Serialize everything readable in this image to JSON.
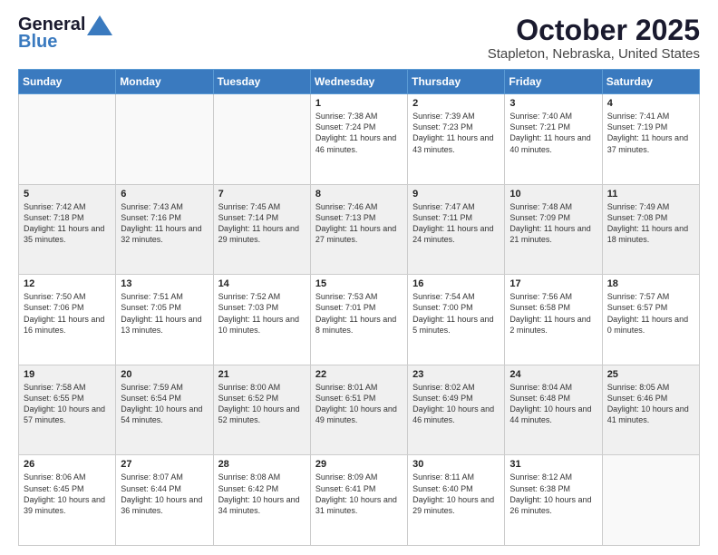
{
  "header": {
    "logo_line1": "General",
    "logo_line2": "Blue",
    "title": "October 2025",
    "subtitle": "Stapleton, Nebraska, United States"
  },
  "weekdays": [
    "Sunday",
    "Monday",
    "Tuesday",
    "Wednesday",
    "Thursday",
    "Friday",
    "Saturday"
  ],
  "weeks": [
    [
      {
        "day": "",
        "info": ""
      },
      {
        "day": "",
        "info": ""
      },
      {
        "day": "",
        "info": ""
      },
      {
        "day": "1",
        "info": "Sunrise: 7:38 AM\nSunset: 7:24 PM\nDaylight: 11 hours and 46 minutes."
      },
      {
        "day": "2",
        "info": "Sunrise: 7:39 AM\nSunset: 7:23 PM\nDaylight: 11 hours and 43 minutes."
      },
      {
        "day": "3",
        "info": "Sunrise: 7:40 AM\nSunset: 7:21 PM\nDaylight: 11 hours and 40 minutes."
      },
      {
        "day": "4",
        "info": "Sunrise: 7:41 AM\nSunset: 7:19 PM\nDaylight: 11 hours and 37 minutes."
      }
    ],
    [
      {
        "day": "5",
        "info": "Sunrise: 7:42 AM\nSunset: 7:18 PM\nDaylight: 11 hours and 35 minutes."
      },
      {
        "day": "6",
        "info": "Sunrise: 7:43 AM\nSunset: 7:16 PM\nDaylight: 11 hours and 32 minutes."
      },
      {
        "day": "7",
        "info": "Sunrise: 7:45 AM\nSunset: 7:14 PM\nDaylight: 11 hours and 29 minutes."
      },
      {
        "day": "8",
        "info": "Sunrise: 7:46 AM\nSunset: 7:13 PM\nDaylight: 11 hours and 27 minutes."
      },
      {
        "day": "9",
        "info": "Sunrise: 7:47 AM\nSunset: 7:11 PM\nDaylight: 11 hours and 24 minutes."
      },
      {
        "day": "10",
        "info": "Sunrise: 7:48 AM\nSunset: 7:09 PM\nDaylight: 11 hours and 21 minutes."
      },
      {
        "day": "11",
        "info": "Sunrise: 7:49 AM\nSunset: 7:08 PM\nDaylight: 11 hours and 18 minutes."
      }
    ],
    [
      {
        "day": "12",
        "info": "Sunrise: 7:50 AM\nSunset: 7:06 PM\nDaylight: 11 hours and 16 minutes."
      },
      {
        "day": "13",
        "info": "Sunrise: 7:51 AM\nSunset: 7:05 PM\nDaylight: 11 hours and 13 minutes."
      },
      {
        "day": "14",
        "info": "Sunrise: 7:52 AM\nSunset: 7:03 PM\nDaylight: 11 hours and 10 minutes."
      },
      {
        "day": "15",
        "info": "Sunrise: 7:53 AM\nSunset: 7:01 PM\nDaylight: 11 hours and 8 minutes."
      },
      {
        "day": "16",
        "info": "Sunrise: 7:54 AM\nSunset: 7:00 PM\nDaylight: 11 hours and 5 minutes."
      },
      {
        "day": "17",
        "info": "Sunrise: 7:56 AM\nSunset: 6:58 PM\nDaylight: 11 hours and 2 minutes."
      },
      {
        "day": "18",
        "info": "Sunrise: 7:57 AM\nSunset: 6:57 PM\nDaylight: 11 hours and 0 minutes."
      }
    ],
    [
      {
        "day": "19",
        "info": "Sunrise: 7:58 AM\nSunset: 6:55 PM\nDaylight: 10 hours and 57 minutes."
      },
      {
        "day": "20",
        "info": "Sunrise: 7:59 AM\nSunset: 6:54 PM\nDaylight: 10 hours and 54 minutes."
      },
      {
        "day": "21",
        "info": "Sunrise: 8:00 AM\nSunset: 6:52 PM\nDaylight: 10 hours and 52 minutes."
      },
      {
        "day": "22",
        "info": "Sunrise: 8:01 AM\nSunset: 6:51 PM\nDaylight: 10 hours and 49 minutes."
      },
      {
        "day": "23",
        "info": "Sunrise: 8:02 AM\nSunset: 6:49 PM\nDaylight: 10 hours and 46 minutes."
      },
      {
        "day": "24",
        "info": "Sunrise: 8:04 AM\nSunset: 6:48 PM\nDaylight: 10 hours and 44 minutes."
      },
      {
        "day": "25",
        "info": "Sunrise: 8:05 AM\nSunset: 6:46 PM\nDaylight: 10 hours and 41 minutes."
      }
    ],
    [
      {
        "day": "26",
        "info": "Sunrise: 8:06 AM\nSunset: 6:45 PM\nDaylight: 10 hours and 39 minutes."
      },
      {
        "day": "27",
        "info": "Sunrise: 8:07 AM\nSunset: 6:44 PM\nDaylight: 10 hours and 36 minutes."
      },
      {
        "day": "28",
        "info": "Sunrise: 8:08 AM\nSunset: 6:42 PM\nDaylight: 10 hours and 34 minutes."
      },
      {
        "day": "29",
        "info": "Sunrise: 8:09 AM\nSunset: 6:41 PM\nDaylight: 10 hours and 31 minutes."
      },
      {
        "day": "30",
        "info": "Sunrise: 8:11 AM\nSunset: 6:40 PM\nDaylight: 10 hours and 29 minutes."
      },
      {
        "day": "31",
        "info": "Sunrise: 8:12 AM\nSunset: 6:38 PM\nDaylight: 10 hours and 26 minutes."
      },
      {
        "day": "",
        "info": ""
      }
    ]
  ]
}
